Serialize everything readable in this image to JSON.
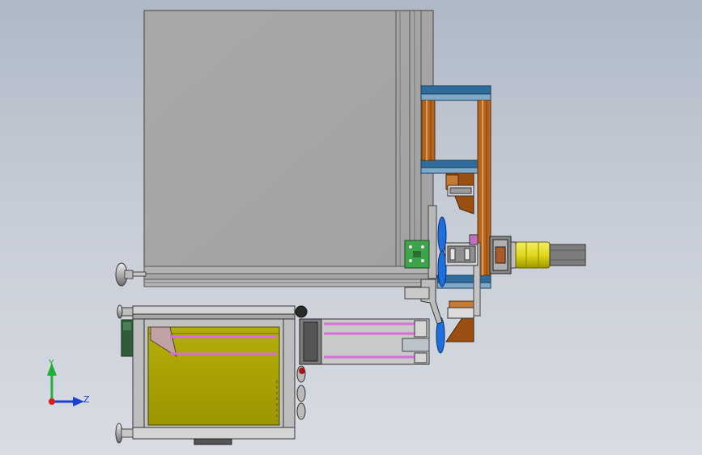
{
  "view": {
    "background_top": "#aeb8c6",
    "background_bottom": "#d8dce3"
  },
  "triad": {
    "y_label": "Y",
    "z_label": "Z",
    "y_color": "#1fae3a",
    "z_color": "#1c3fd4",
    "x_color": "#d42020"
  },
  "colors": {
    "frame_gray": "#a9a9a9",
    "frame_edge": "#5a5a5a",
    "rail_blue": "#2d6c9c",
    "wood_brown": "#b5651d",
    "box_yellow": "#a7a200",
    "rod_pink": "#d86fd8",
    "motor_yellow": "#e4dc1a",
    "motor_gray": "#7d7d7d",
    "board_green": "#3fa34d",
    "dark_green": "#2f5d3a"
  }
}
